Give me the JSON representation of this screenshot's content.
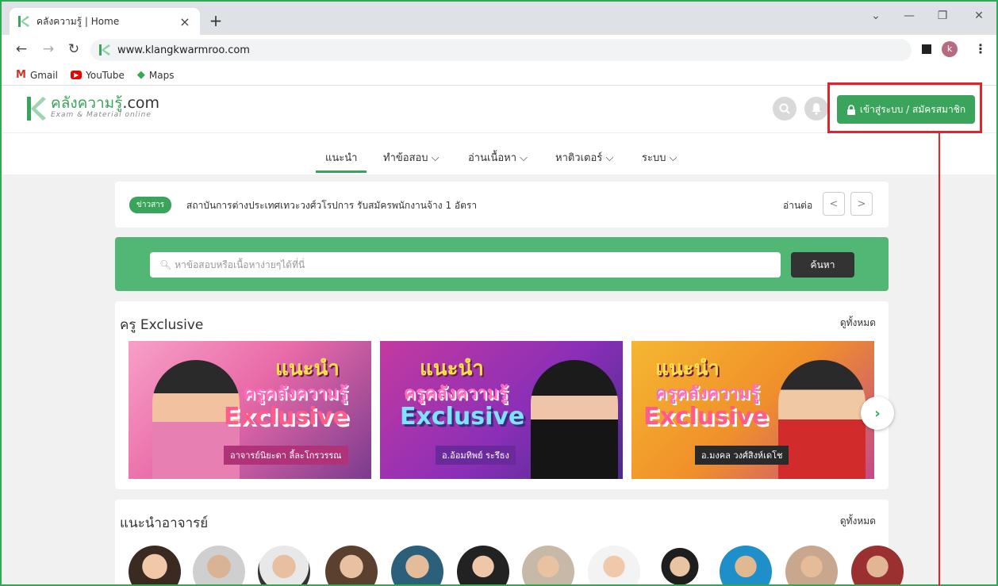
{
  "browser": {
    "tab_title": "คลังความรู้ | Home",
    "tab_close": "×",
    "new_tab": "+",
    "url": "www.klangkwarmroo.com",
    "profile_initial": "k",
    "bookmarks": [
      {
        "label": "Gmail",
        "icon": "gmail-icon"
      },
      {
        "label": "YouTube",
        "icon": "youtube-icon"
      },
      {
        "label": "Maps",
        "icon": "maps-icon"
      }
    ]
  },
  "site": {
    "brand_thai": "คลังความรู้",
    "brand_suffix": ".com",
    "tagline": "Exam & Material online",
    "login_label": "เข้าสู่ระบบ / สมัครสมาชิก",
    "accent": "#3aa35c",
    "highlight_color": "#e8202a"
  },
  "menu": [
    "แนะนำ",
    "ทำข้อสอบ",
    "อ่านเนื้อหา",
    "หาติวเตอร์",
    "ระบบ"
  ],
  "news": {
    "badge": "ข่าวสาร",
    "text": "สถาบันการต่างประเทศเทวะวงศ์วโรปการ รับสมัครพนักงานจ้าง 1 อัตรา",
    "read_more": "อ่านต่อ",
    "prev": "<",
    "next": ">"
  },
  "search": {
    "placeholder": "หาข้อสอบหรือเนื้อหาง่ายๆได้ที่นี่",
    "button": "ค้นหา"
  },
  "exclusive": {
    "title": "ครู Exclusive",
    "see_all": "ดูทั้งหมด",
    "banners": [
      {
        "line1": "แนะนำ",
        "line2": "ครูคลังความรู้",
        "line3": "Exclusive",
        "name": "อาจารย์นิยะดา ลี้ละโกรวรรณ"
      },
      {
        "line1": "แนะนำ",
        "line2": "ครูคลังความรู้",
        "line3": "Exclusive",
        "name": "อ.อ้อมทิพย์ ระรึธง"
      },
      {
        "line1": "แนะนำ",
        "line2": "ครูคลังความรู้",
        "line3": "Exclusive",
        "name": "อ.มงคล วงศ์สิงห์เดโช"
      }
    ],
    "next": "›"
  },
  "teachers": {
    "title": "แนะนำอาจารย์",
    "see_all": "ดูทั้งหมด"
  }
}
